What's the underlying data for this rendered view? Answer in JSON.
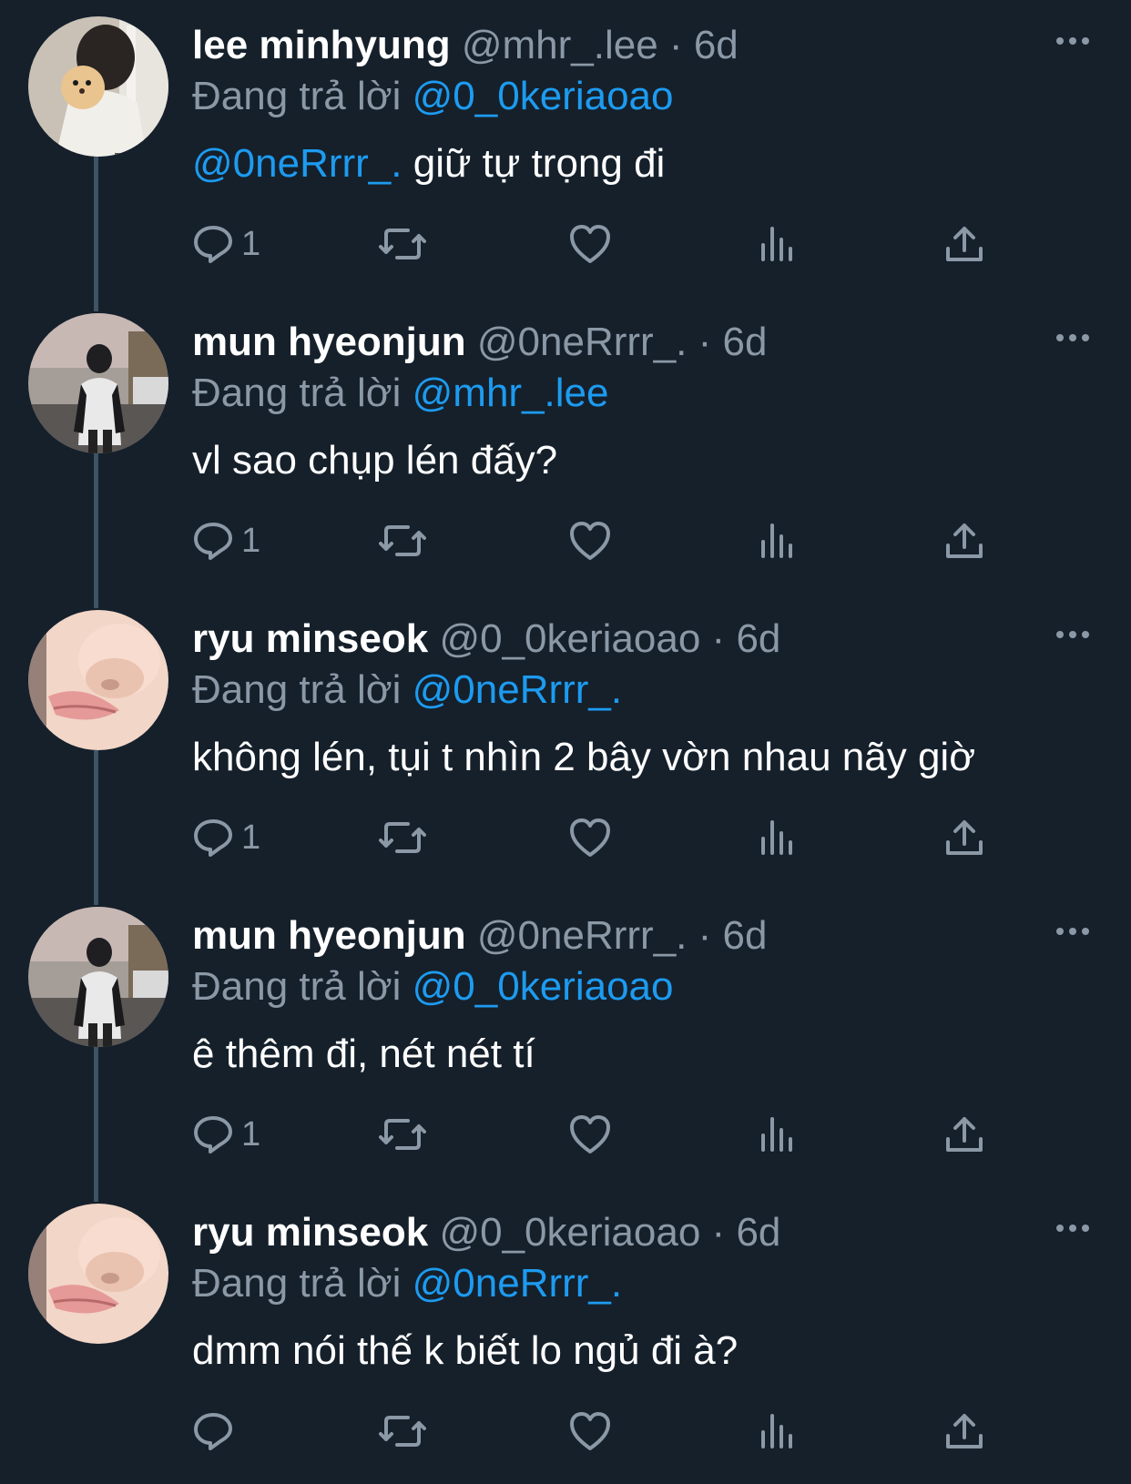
{
  "reply_prefix": "Đang trả lời",
  "colors": {
    "background": "#15202b",
    "text": "#ffffff",
    "muted": "#8b98a5",
    "link": "#1d9bf0",
    "thread_line": "#3d5466"
  },
  "tweets": [
    {
      "name": "lee minhyung",
      "handle": "@mhr_.lee",
      "time": "6d",
      "reply_to": "@0_0keriaoao",
      "text_mention": "@0neRrrr_.",
      "text": " giữ tự trọng đi",
      "reply_count": "1",
      "avatar": "avatar-dog-hug"
    },
    {
      "name": "mun hyeonjun",
      "handle": "@0neRrrr_.",
      "time": "6d",
      "reply_to": "@mhr_.lee",
      "text_mention": "",
      "text": "vl sao chụp lén đấy?",
      "reply_count": "1",
      "avatar": "avatar-street-photo"
    },
    {
      "name": "ryu minseok",
      "handle": "@0_0keriaoao",
      "time": "6d",
      "reply_to": "@0neRrrr_.",
      "text_mention": "",
      "text": "không lén, tụi t nhìn 2 bây vờn nhau nãy giờ",
      "reply_count": "1",
      "avatar": "avatar-face-closeup"
    },
    {
      "name": "mun hyeonjun",
      "handle": "@0neRrrr_.",
      "time": "6d",
      "reply_to": "@0_0keriaoao",
      "text_mention": "",
      "text": "ê thêm đi, nét nét tí",
      "reply_count": "1",
      "avatar": "avatar-street-photo"
    },
    {
      "name": "ryu minseok",
      "handle": "@0_0keriaoao",
      "time": "6d",
      "reply_to": "@0neRrrr_.",
      "text_mention": "",
      "text": "dmm nói thế k biết lo ngủ đi à?",
      "reply_count": "",
      "avatar": "avatar-face-closeup"
    }
  ]
}
